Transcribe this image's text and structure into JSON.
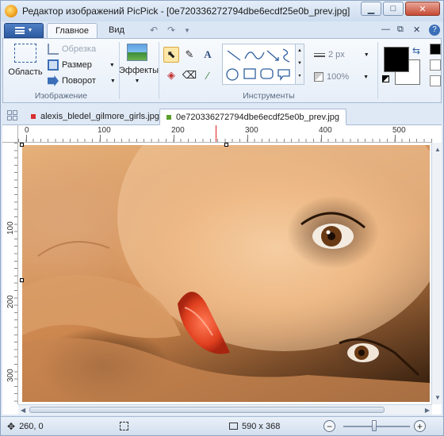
{
  "window": {
    "title": "Редактор изображений PicPick - [0e720336272794dbe6ecdf25e0b_prev.jpg]"
  },
  "ribbon_tabs": {
    "home": "Главное",
    "view": "Вид"
  },
  "ribbon": {
    "image_group": {
      "label": "Изображение",
      "select_area": "Область",
      "crop": "Обрезка",
      "resize": "Размер",
      "rotate": "Поворот"
    },
    "effects": "Эффекты",
    "tools_group": {
      "label": "Инструменты",
      "line_width": "2 px",
      "opacity": "100%"
    },
    "colors": {
      "primary": "#000000",
      "secondary": "#ffffff"
    }
  },
  "document_tabs": [
    {
      "label": "alexis_bledel_gilmore_girls.jpg",
      "color": "#d83030"
    },
    {
      "label": "0e720336272794dbe6ecdf25e0b_prev.jpg",
      "color": "#5aa02c"
    }
  ],
  "ruler": {
    "h_labels": [
      "0",
      "100",
      "200",
      "300",
      "400",
      "500"
    ],
    "v_labels": [
      "100",
      "200",
      "300"
    ]
  },
  "statusbar": {
    "cursor_pos": "260, 0",
    "image_size": "590 x 368"
  }
}
